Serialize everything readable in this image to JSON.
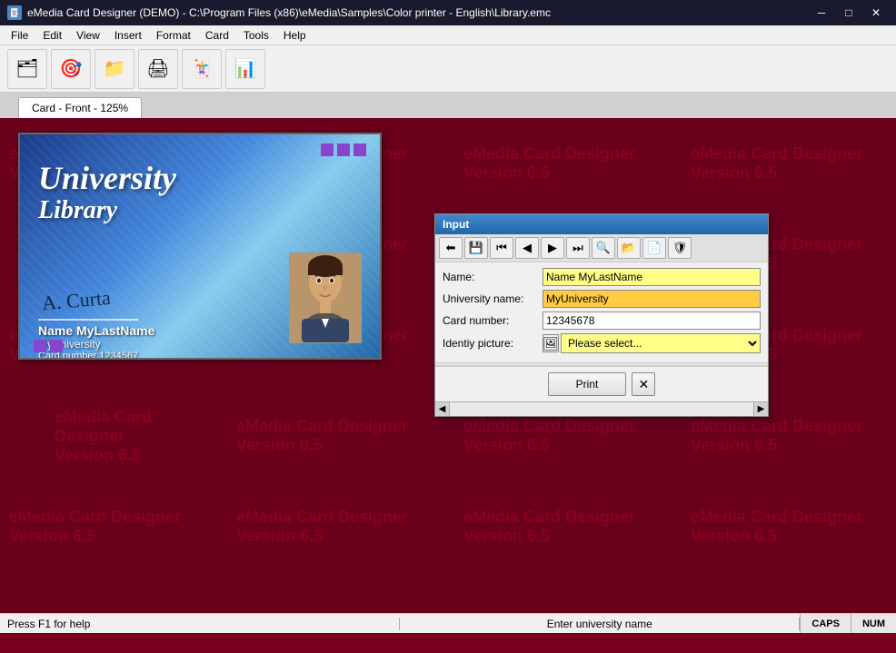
{
  "window": {
    "title": "eMedia Card Designer (DEMO) - C:\\Program Files (x86)\\eMedia\\Samples\\Color printer - English\\Library.emc",
    "icon": "🃏"
  },
  "titlebar": {
    "minimize": "─",
    "maximize": "□",
    "close": "✕"
  },
  "menubar": {
    "items": [
      "File",
      "Edit",
      "View",
      "Insert",
      "Format",
      "Card",
      "Tools",
      "Help"
    ]
  },
  "toolbar": {
    "buttons": [
      {
        "icon": "🗂",
        "label": ""
      },
      {
        "icon": "🎯",
        "label": ""
      },
      {
        "icon": "📁",
        "label": ""
      },
      {
        "icon": "🖨",
        "label": ""
      },
      {
        "icon": "🃏",
        "label": ""
      },
      {
        "icon": "📊",
        "label": ""
      }
    ]
  },
  "tab": {
    "label": "Card - Front - 125%"
  },
  "watermark": {
    "line1": "eMedia Card Designer",
    "line2": "Version 6.5"
  },
  "card": {
    "title_line1": "University",
    "title_line2": "University Library",
    "name": "Name MyLastName",
    "university": "MyUniversity",
    "card_number": "Card number 1234567",
    "signature": "A. Curta"
  },
  "dialog": {
    "title": "Input",
    "toolbar_buttons": [
      "⬅",
      "💾",
      "⏮",
      "◀",
      "▶",
      "⏭",
      "🔍",
      "📂",
      "📄",
      "🛡"
    ],
    "fields": [
      {
        "label": "Name:",
        "value": "Name MyLastName",
        "style": "yellow"
      },
      {
        "label": "University name:",
        "value": "MyUniversity",
        "style": "orange"
      },
      {
        "label": "Card number:",
        "value": "12345678",
        "style": "white"
      },
      {
        "label": "Identiy picture:",
        "value": "Please select...",
        "style": "select"
      }
    ],
    "print_button": "Print",
    "cancel_button": "✕"
  },
  "statusbar": {
    "left": "Press F1 for help",
    "middle": "Enter university name",
    "caps": "CAPS",
    "num": "NUM"
  }
}
